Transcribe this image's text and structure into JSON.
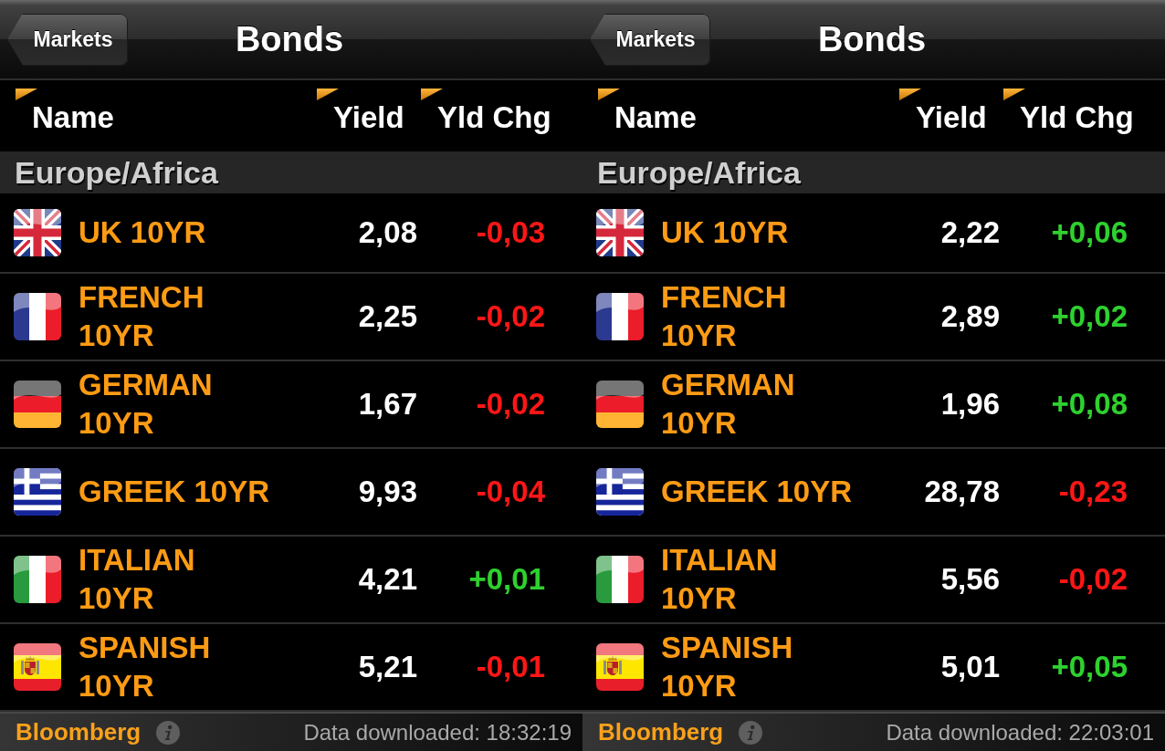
{
  "panels": [
    {
      "nav_bar": {
        "back_button": "Markets",
        "title": "Bonds"
      },
      "columns": [
        "Name",
        "Yield",
        "Yld Chg"
      ],
      "section": "Europe/Africa",
      "rows": [
        {
          "kind": "uk",
          "name": "UK 10YR",
          "yield": "2,08",
          "change": "-0,03",
          "color": "#ff1616"
        },
        {
          "kind": "france",
          "name": "FRENCH 10YR",
          "yield": "2,25",
          "change": "-0,02",
          "color": "#ff1616"
        },
        {
          "kind": "germany",
          "name": "GERMAN 10YR",
          "yield": "1,67",
          "change": "-0,02",
          "color": "#ff1616"
        },
        {
          "kind": "greece",
          "name": "GREEK 10YR",
          "yield": "9,93",
          "change": "-0,04",
          "color": "#ff1616"
        },
        {
          "kind": "italy",
          "name": "ITALIAN 10YR",
          "yield": "4,21",
          "change": "+0,01",
          "color": "#2ed12e"
        },
        {
          "kind": "spain",
          "name": "SPANISH 10YR",
          "yield": "5,21",
          "change": "-0,01",
          "color": "#ff1616"
        }
      ],
      "footer": {
        "brand": "Bloomberg",
        "status": "Data downloaded: 18:32:19"
      }
    },
    {
      "nav_bar": {
        "back_button": "Markets",
        "title": "Bonds"
      },
      "columns": [
        "Name",
        "Yield",
        "Yld Chg"
      ],
      "section": "Europe/Africa",
      "rows": [
        {
          "kind": "uk",
          "name": "UK 10YR",
          "yield": "2,22",
          "change": "+0,06",
          "color": "#2ed12e"
        },
        {
          "kind": "france",
          "name": "FRENCH 10YR",
          "yield": "2,89",
          "change": "+0,02",
          "color": "#2ed12e"
        },
        {
          "kind": "germany",
          "name": "GERMAN 10YR",
          "yield": "1,96",
          "change": "+0,08",
          "color": "#2ed12e"
        },
        {
          "kind": "greece",
          "name": "GREEK 10YR",
          "yield": "28,78",
          "change": "-0,23",
          "color": "#ff1616"
        },
        {
          "kind": "italy",
          "name": "ITALIAN 10YR",
          "yield": "5,56",
          "change": "-0,02",
          "color": "#ff1616"
        },
        {
          "kind": "spain",
          "name": "SPANISH 10YR",
          "yield": "5,01",
          "change": "+0,05",
          "color": "#2ed12e"
        }
      ],
      "footer": {
        "brand": "Bloomberg",
        "status": "Data downloaded: 22:03:01"
      }
    }
  ]
}
